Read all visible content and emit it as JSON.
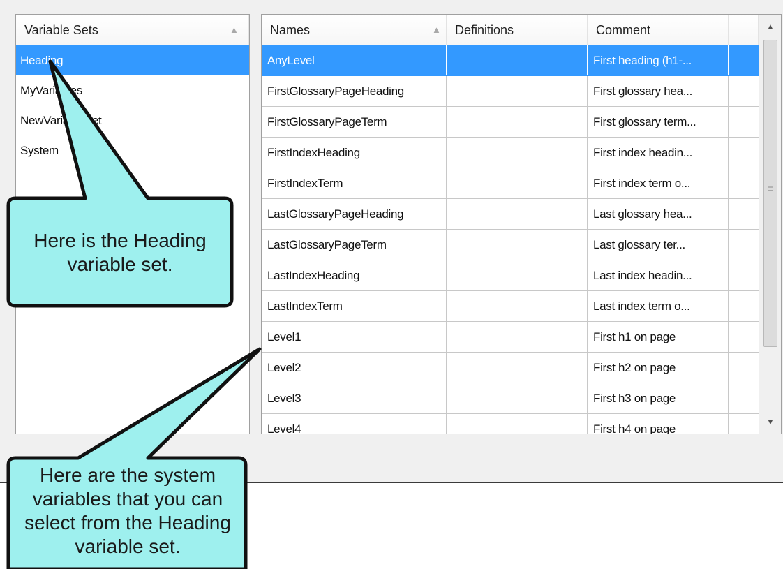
{
  "variable_sets": {
    "header": "Variable Sets",
    "items": [
      {
        "label": "Heading",
        "selected": true
      },
      {
        "label": "MyVariables",
        "selected": false
      },
      {
        "label": "NewVariableSet",
        "selected": false
      },
      {
        "label": "System",
        "selected": false
      }
    ]
  },
  "variables_grid": {
    "columns": [
      "Names",
      "Definitions",
      "Comment"
    ],
    "rows": [
      {
        "name": "AnyLevel",
        "definition": "",
        "comment": "First heading (h1-...",
        "selected": true
      },
      {
        "name": "FirstGlossaryPageHeading",
        "definition": "",
        "comment": "First glossary hea...",
        "selected": false
      },
      {
        "name": "FirstGlossaryPageTerm",
        "definition": "",
        "comment": "First glossary term...",
        "selected": false
      },
      {
        "name": "FirstIndexHeading",
        "definition": "",
        "comment": "First index headin...",
        "selected": false
      },
      {
        "name": "FirstIndexTerm",
        "definition": "",
        "comment": "First index term o...",
        "selected": false
      },
      {
        "name": "LastGlossaryPageHeading",
        "definition": "",
        "comment": "Last glossary hea...",
        "selected": false
      },
      {
        "name": "LastGlossaryPageTerm",
        "definition": "",
        "comment": "Last glossary ter...",
        "selected": false
      },
      {
        "name": "LastIndexHeading",
        "definition": "",
        "comment": "Last index headin...",
        "selected": false
      },
      {
        "name": "LastIndexTerm",
        "definition": "",
        "comment": "Last index term o...",
        "selected": false
      },
      {
        "name": "Level1",
        "definition": "",
        "comment": "First h1 on page",
        "selected": false
      },
      {
        "name": "Level2",
        "definition": "",
        "comment": "First h2 on page",
        "selected": false
      },
      {
        "name": "Level3",
        "definition": "",
        "comment": "First h3 on page",
        "selected": false
      },
      {
        "name": "Level4",
        "definition": "",
        "comment": "First h4 on page",
        "selected": false
      }
    ]
  },
  "callouts": {
    "heading_set": "Here is the Heading variable set.",
    "system_vars": "Here are the system variables that you can select from the Heading variable set."
  },
  "colors": {
    "selection": "#3399ff",
    "callout_fill": "#9ef0ee",
    "callout_stroke": "#111111"
  }
}
